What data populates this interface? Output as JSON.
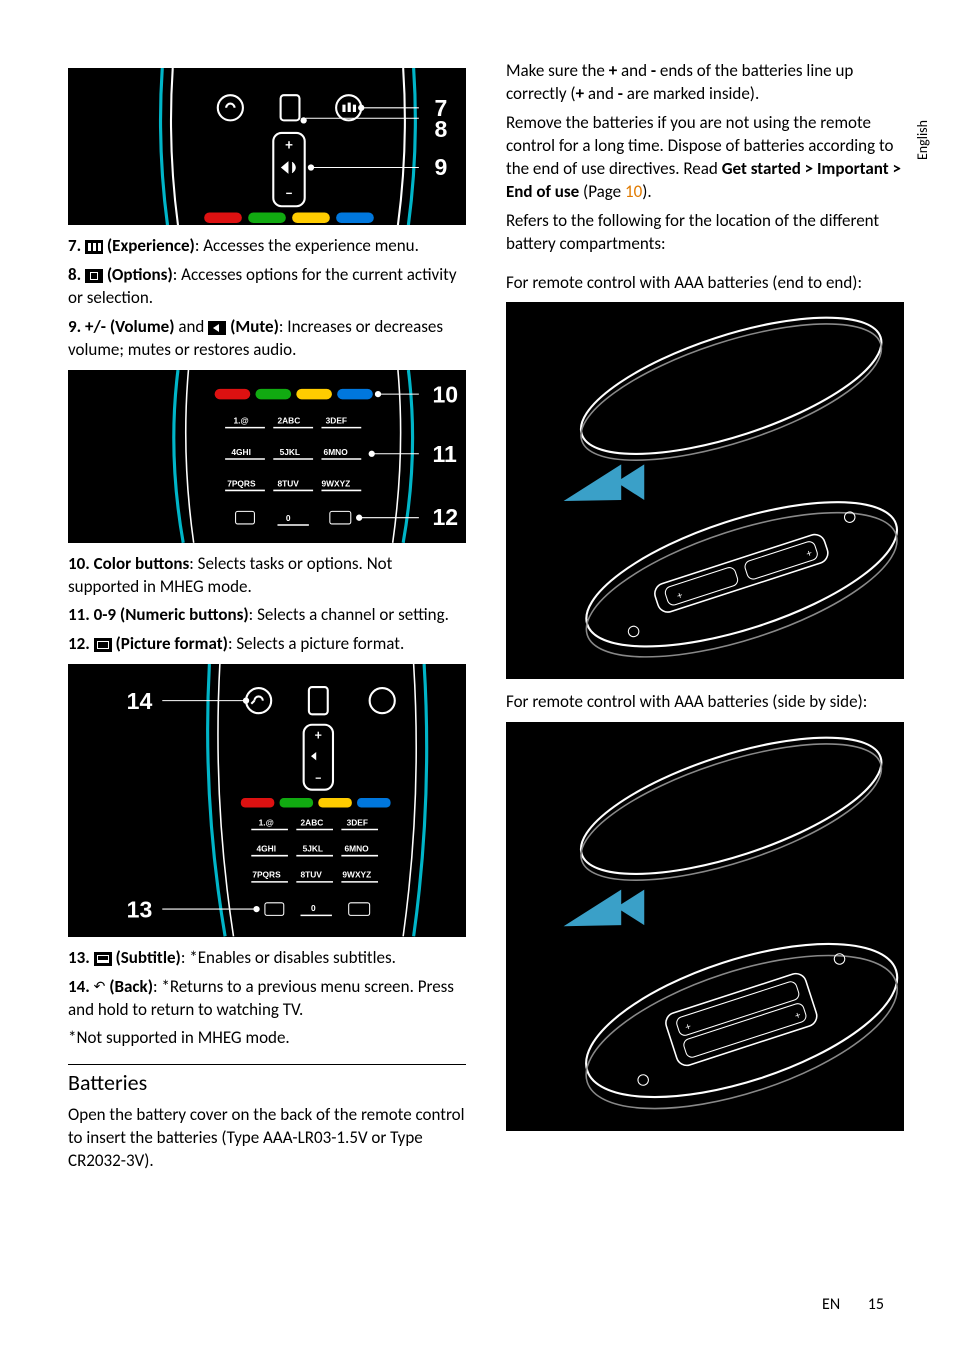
{
  "side_label": "English",
  "left": {
    "item7": {
      "num": "7.",
      "name": "(Experience)",
      "desc": ": Accesses the experience menu."
    },
    "item8": {
      "num": "8.",
      "name": "(Options)",
      "desc": ": Accesses options for the current activity or selection."
    },
    "item9": {
      "num": "9. +/-",
      "vol": "(Volume)",
      "and": " and ",
      "mute": "(Mute)",
      "desc": ": Increases or decreases volume; mutes or restores audio."
    },
    "item10": {
      "num": "10.",
      "name": "Color buttons",
      "desc": ": Selects tasks or options. Not supported in MHEG mode."
    },
    "item11": {
      "num": "11. 0-9",
      "name": "(Numeric buttons)",
      "desc": ": Selects a channel or setting."
    },
    "item12": {
      "num": "12.",
      "name": "(Picture format)",
      "desc": ": Selects a picture format."
    },
    "item13": {
      "num": "13.",
      "name": "(Subtitle)",
      "desc": ": *Enables or disables subtitles."
    },
    "item14": {
      "num": "14.",
      "name": "(Back)",
      "desc": ": *Returns to a previous menu screen. Press and hold to return to watching TV."
    },
    "item_foot": "*Not supported in MHEG mode.",
    "section": "Batteries",
    "batteries_open": "Open the battery cover on the back of the remote control to insert the batteries (Type AAA-LR03-1.5V or Type CR2032-3V)."
  },
  "right": {
    "p1a": "Make sure the ",
    "p1b": " and ",
    "p1c": " ends of the batteries line up correctly (",
    "p1d": " and ",
    "p1e": " are marked inside).",
    "plus": "+",
    "minus": "-",
    "p2": "Remove the batteries if you are not using the remote control for a long time. Dispose of batteries according to the end of use directives. Read ",
    "p2_path": "Get started > Important > End of use",
    "p2_page_label": " (Page ",
    "p2_page": "10",
    "p2_close": ").",
    "p3": "Refers to the following for the location of the different battery compartments:",
    "p4": "For remote control with AAA batteries (end to end):",
    "p5": "For remote control with AAA batteries (side by side):"
  },
  "footer": {
    "lang": "EN",
    "page": "15"
  },
  "labels": {
    "n7": "7",
    "n8": "8",
    "n9": "9",
    "n10": "10",
    "n11": "11",
    "n12": "12",
    "n13": "13",
    "n14": "14"
  }
}
